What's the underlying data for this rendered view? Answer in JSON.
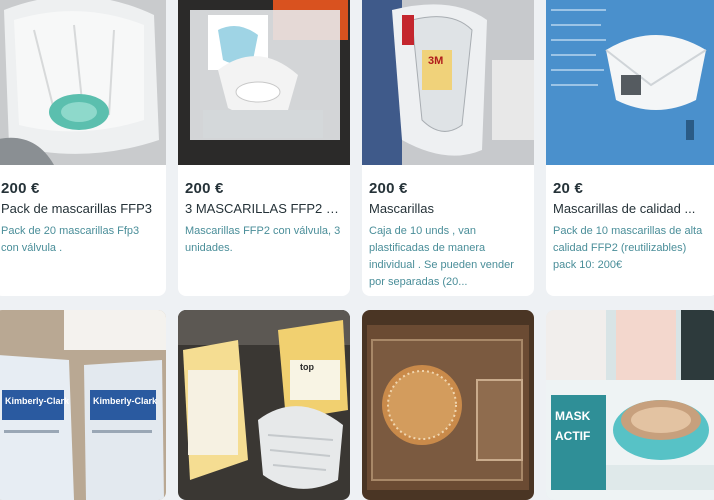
{
  "listings": [
    {
      "price": "200 €",
      "title": "Pack de mascarillas FFP3",
      "description": "Pack de 20 mascarillas Ffp3 con válvula .",
      "image": "white-ffp3-mask-with-teal-valve-in-bag"
    },
    {
      "price": "200 €",
      "title": "3 MASCARILLAS FFP2 C...",
      "description": "Mascarillas FFP2 con válvula, 3 unidades.",
      "image": "ffp2-masks-in-plastic-package"
    },
    {
      "price": "200 €",
      "title": "Mascarillas",
      "description": "Caja de 10 unds , van plastificadas de manera individual . Se pueden vender por separadas (20...",
      "image": "3m-mask-wrapped-in-plastic"
    },
    {
      "price": "20 €",
      "title": "Mascarillas de calidad ...",
      "description": "Pack de 10 mascarillas de alta calidad FFP2 (reutilizables) pack 10: 200€",
      "image": "folded-ffp2-mask-on-blue-box"
    },
    {
      "price": "",
      "title": "",
      "description": "",
      "image": "kimberly-clark-mask-boxes"
    },
    {
      "price": "",
      "title": "",
      "description": "",
      "image": "yellow-mask-boxes-and-white-mask"
    },
    {
      "price": "",
      "title": "",
      "description": "",
      "image": "copper-device-in-clear-case"
    },
    {
      "price": "",
      "title": "",
      "description": "",
      "image": "cosmetic-mask-sheets-and-turquoise-jar"
    }
  ],
  "photo_text": {
    "kimberly_1": "Kimberly-Clark",
    "kimberly_2": "Kimberly-Clark",
    "box_label": "top",
    "mask_label": "MASK",
    "actif_label": "ACTIF",
    "brand_3m": "3M"
  }
}
